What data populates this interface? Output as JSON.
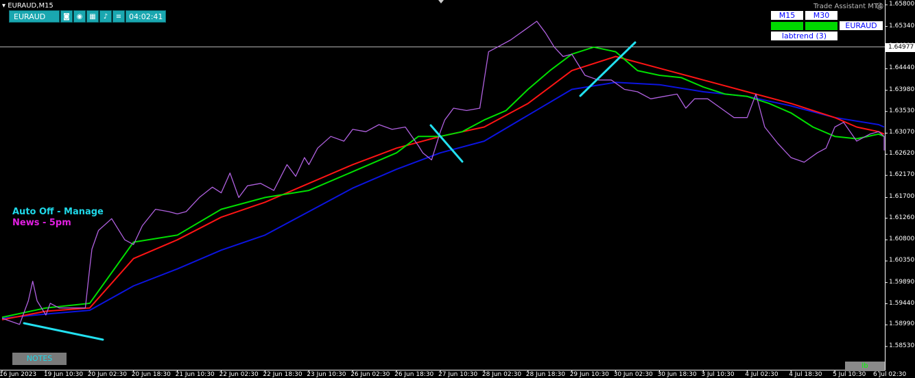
{
  "window_title": "EURAUD,M15",
  "toolbar": {
    "symbol": "EURAUD",
    "time": "04:02:41",
    "icons": [
      "camera-icon",
      "eye-icon",
      "calendar-icon",
      "bell-icon",
      "list-icon"
    ]
  },
  "trade_assistant": "Trade Assistant MT4",
  "timeframe_panel": {
    "tf1": "M15",
    "tf2": "M30",
    "symbol": "EURAUD",
    "indicator": "labtrend (3)"
  },
  "overlay": {
    "line1": "Auto Off - Manage",
    "line2": "News - 5pm"
  },
  "notes_button": "NOTES",
  "lb_button": "lb",
  "current_price": "1.64977",
  "colors": {
    "price": "#b061e0",
    "ema_green": "#00e000",
    "ema_red": "#ff1414",
    "ema_blue": "#0c14e0",
    "trendline": "#22e0f0",
    "crosshair": "#b4b4b4"
  },
  "chart_data": {
    "type": "line",
    "ylim": [
      1.5853,
      1.658
    ],
    "y_ticks": [
      "1.65800",
      "1.65340",
      "1.64910",
      "1.64440",
      "1.63980",
      "1.63530",
      "1.63070",
      "1.62620",
      "1.62170",
      "1.61700",
      "1.61260",
      "1.60800",
      "1.60350",
      "1.59890",
      "1.59440",
      "1.58990",
      "1.58530"
    ],
    "x_ticks": [
      "16 Jun 2023",
      "19 Jun 10:30",
      "20 Jun 02:30",
      "20 Jun 18:30",
      "21 Jun 10:30",
      "22 Jun 02:30",
      "22 Jun 18:30",
      "23 Jun 10:30",
      "26 Jun 02:30",
      "26 Jun 18:30",
      "27 Jun 10:30",
      "28 Jun 02:30",
      "28 Jun 18:30",
      "29 Jun 10:30",
      "30 Jun 02:30",
      "30 Jun 18:30",
      "3 Jul 10:30",
      "4 Jul 02:30",
      "4 Jul 18:30",
      "5 Jul 10:30",
      "6 Jul 02:30"
    ],
    "x_range": [
      0,
      20.4
    ],
    "series": [
      {
        "color": "#b061e0",
        "x": [
          0,
          0.4,
          0.6,
          0.7,
          0.8,
          1.0,
          1.1,
          1.3,
          1.6,
          1.9,
          2.0,
          2.05,
          2.2,
          2.5,
          2.8,
          3.0,
          3.2,
          3.5,
          3.8,
          4.0,
          4.2,
          4.5,
          4.8,
          5.0,
          5.2,
          5.4,
          5.6,
          5.9,
          6.2,
          6.5,
          6.7,
          6.9,
          7.0,
          7.2,
          7.5,
          7.8,
          8.0,
          8.3,
          8.6,
          8.9,
          9.2,
          9.5,
          9.6,
          9.8,
          10.0,
          10.1,
          10.3,
          10.6,
          10.9,
          11.0,
          11.1,
          11.3,
          11.6,
          11.9,
          12.2,
          12.4,
          12.6,
          12.8,
          13.0,
          13.3,
          13.6,
          13.9,
          14.2,
          14.5,
          14.8,
          15.1,
          15.4,
          15.6,
          15.8,
          16.1,
          16.4,
          16.7,
          17.0,
          17.2,
          17.4,
          17.7,
          18.0,
          18.3,
          18.6,
          18.8,
          19.0,
          19.2,
          19.5,
          19.8,
          20.0,
          20.2,
          20.4
        ],
        "y": [
          1.5913,
          1.59,
          1.595,
          1.5992,
          1.595,
          1.592,
          1.5945,
          1.5935,
          1.5935,
          1.5935,
          1.602,
          1.606,
          1.61,
          1.6125,
          1.608,
          1.607,
          1.611,
          1.6145,
          1.614,
          1.6135,
          1.614,
          1.617,
          1.6192,
          1.618,
          1.6222,
          1.617,
          1.6195,
          1.62,
          1.6185,
          1.624,
          1.6215,
          1.6255,
          1.624,
          1.6275,
          1.63,
          1.629,
          1.6315,
          1.631,
          1.6325,
          1.6315,
          1.632,
          1.628,
          1.6265,
          1.625,
          1.631,
          1.6335,
          1.636,
          1.6355,
          1.636,
          1.642,
          1.648,
          1.649,
          1.6505,
          1.6525,
          1.6545,
          1.652,
          1.649,
          1.647,
          1.6475,
          1.643,
          1.642,
          1.642,
          1.64,
          1.6395,
          1.638,
          1.6385,
          1.639,
          1.636,
          1.638,
          1.638,
          1.636,
          1.634,
          1.634,
          1.639,
          1.632,
          1.6285,
          1.6255,
          1.6245,
          1.6265,
          1.6275,
          1.632,
          1.633,
          1.629,
          1.6305,
          1.631,
          1.63,
          1.627
        ]
      },
      {
        "color": "#00e000",
        "x": [
          0,
          1.0,
          2.0,
          3.0,
          4.0,
          5.0,
          6.0,
          7.0,
          8.0,
          9.0,
          9.5,
          10.0,
          10.5,
          11.0,
          11.5,
          12.0,
          12.5,
          13.0,
          13.5,
          14.0,
          14.5,
          15.0,
          15.5,
          16.0,
          16.5,
          17.0,
          17.5,
          18.0,
          18.5,
          19.0,
          19.5,
          20.0,
          20.4
        ],
        "y": [
          1.5915,
          1.5935,
          1.5945,
          1.6075,
          1.609,
          1.6145,
          1.617,
          1.6185,
          1.6225,
          1.6265,
          1.63,
          1.63,
          1.631,
          1.6335,
          1.6355,
          1.64,
          1.644,
          1.6475,
          1.649,
          1.648,
          1.644,
          1.643,
          1.6425,
          1.6405,
          1.639,
          1.6385,
          1.637,
          1.635,
          1.632,
          1.63,
          1.6295,
          1.6305,
          1.63
        ]
      },
      {
        "color": "#ff1414",
        "x": [
          0,
          1.0,
          2.0,
          3.0,
          4.0,
          5.0,
          6.0,
          7.0,
          8.0,
          9.0,
          10.0,
          11.0,
          12.0,
          13.0,
          14.0,
          15.0,
          16.0,
          17.0,
          18.0,
          19.0,
          19.5,
          20.0,
          20.4
        ],
        "y": [
          1.591,
          1.5928,
          1.5935,
          1.604,
          1.608,
          1.6128,
          1.616,
          1.62,
          1.624,
          1.6275,
          1.63,
          1.632,
          1.637,
          1.644,
          1.647,
          1.6445,
          1.642,
          1.6395,
          1.637,
          1.634,
          1.632,
          1.631,
          1.6305
        ]
      },
      {
        "color": "#0c14e0",
        "x": [
          0,
          1.0,
          2.0,
          3.0,
          4.0,
          5.0,
          6.0,
          7.0,
          8.0,
          9.0,
          10.0,
          11.0,
          12.0,
          13.0,
          14.0,
          15.0,
          16.0,
          17.0,
          18.0,
          19.0,
          20.0,
          20.4
        ],
        "y": [
          1.5913,
          1.5922,
          1.593,
          1.5982,
          1.6018,
          1.6058,
          1.609,
          1.614,
          1.619,
          1.623,
          1.6265,
          1.629,
          1.6345,
          1.64,
          1.6415,
          1.641,
          1.6395,
          1.6385,
          1.6365,
          1.634,
          1.6325,
          1.632
        ]
      }
    ]
  }
}
